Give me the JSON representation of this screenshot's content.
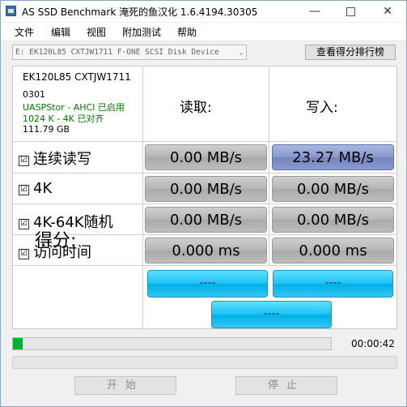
{
  "window": {
    "title": "AS SSD Benchmark 淹死的鱼汉化 1.6.4194.30305"
  },
  "titlebar_buttons": {
    "minimize": "—",
    "close": "✕"
  },
  "menu": [
    "文件",
    "编辑",
    "视图",
    "附加测试",
    "帮助"
  ],
  "drive_select": {
    "value": "E: EK120L85 CXTJW1711  F-ONE SCSI Disk Device",
    "icon": "chevron-down-icon"
  },
  "rank_button": "查看得分排行榜",
  "drive_info": {
    "model": "EK120L85 CXTJW1711",
    "firmware": "0301",
    "driver": "UASPStor - AHCI 已启用",
    "alignment": "1024 K - 4K 已对齐",
    "size": "111.79 GB",
    "status_color": "#008000"
  },
  "headers": {
    "read": "读取:",
    "write": "写入:"
  },
  "rows": [
    {
      "label": "连续读写",
      "checked": "☑",
      "read": "0.00 MB/s",
      "write": "23.27 MB/s"
    },
    {
      "label": "4K",
      "checked": "☑",
      "read": "0.00 MB/s",
      "write": "0.00 MB/s"
    },
    {
      "label": "4K-64K随机",
      "checked": "☑",
      "read": "0.00 MB/s",
      "write": "0.00 MB/s"
    },
    {
      "label": "访问时间",
      "checked": "☑",
      "read": "0.000 ms",
      "write": "0.000 ms"
    }
  ],
  "score": {
    "label": "得分:",
    "read": "----",
    "write": "----",
    "total": "----"
  },
  "progress": {
    "percent": 3,
    "elapsed": "00:00:42"
  },
  "buttons": {
    "start": "开始",
    "stop": "停止"
  },
  "colors": {
    "accent_score": "#19c3f4",
    "active_cell": "#8797cc",
    "progress": "#06b025"
  }
}
